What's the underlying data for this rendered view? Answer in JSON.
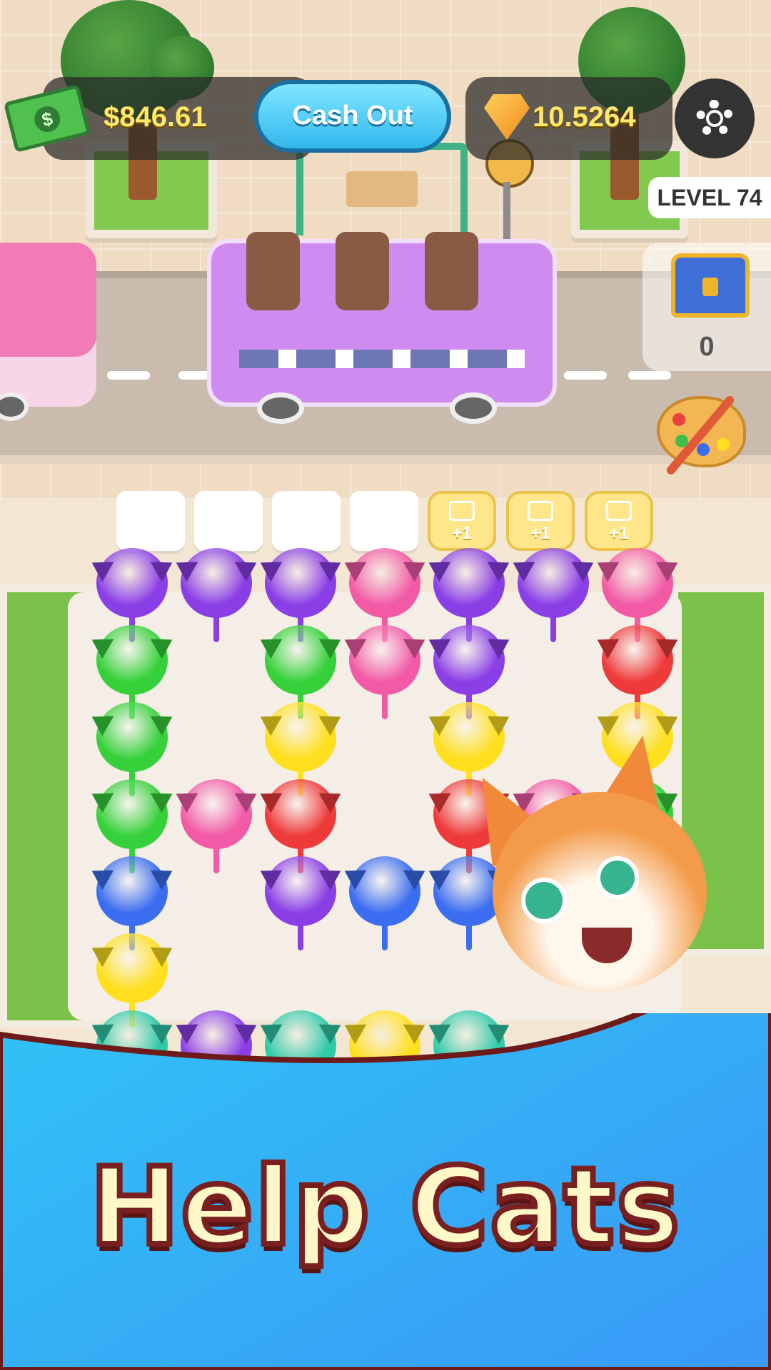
{
  "hud": {
    "cash_amount": "$846.61",
    "cash_out_label": "Cash Out",
    "gem_amount": "10.5264",
    "level_label": "LEVEL 74",
    "chest_count": "0"
  },
  "slots": {
    "empty_count": 4,
    "ad_slots": [
      "+1",
      "+1",
      "+1"
    ]
  },
  "banner": {
    "title": "Help Cats"
  },
  "colors": {
    "purple": "#8a3ee6",
    "pink": "#f25aa6",
    "green": "#36d13a",
    "red": "#ee3a3a",
    "yellow": "#ffdf1e",
    "blue": "#3b6df0",
    "teal": "#2fcaa8",
    "banner_top": "#2fc7f5",
    "banner_bottom": "#3aa0f7"
  },
  "board_rows": [
    [
      "purple",
      "purple",
      "purple",
      "pink",
      "purple",
      "purple",
      "pink"
    ],
    [
      "green",
      "",
      "green",
      "pink",
      "purple",
      "",
      "red"
    ],
    [
      "green",
      "",
      "yellow",
      "",
      "yellow",
      "",
      "yellow"
    ],
    [
      "green",
      "pink",
      "red",
      "",
      "red",
      "pink",
      "green"
    ],
    [
      "blue",
      "",
      "purple",
      "blue",
      "blue",
      "",
      ""
    ],
    [
      "yellow",
      "",
      "",
      "",
      "",
      "",
      ""
    ],
    [
      "teal",
      "purple",
      "teal",
      "yellow",
      "teal",
      "",
      ""
    ]
  ]
}
